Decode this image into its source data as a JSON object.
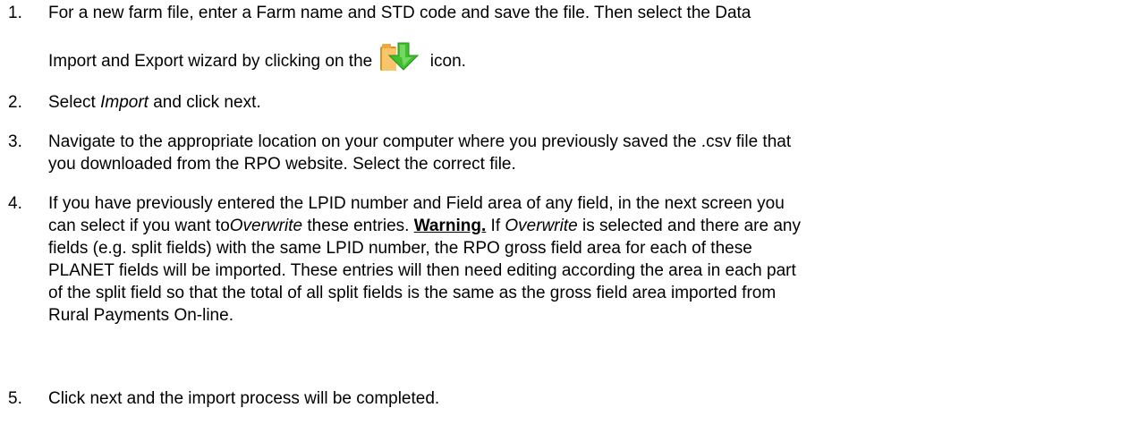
{
  "steps": [
    {
      "num": "1.",
      "line1": "For a new farm file, enter a Farm name and STD code and save the file. Then select the Data",
      "line2_before": "Import and Export wizard by clicking on the",
      "line2_after": "icon.",
      "icon": "folder-import-icon"
    },
    {
      "num": "2.",
      "before": "Select ",
      "em": "Import",
      "after": " and click next."
    },
    {
      "num": "3.",
      "line1": "Navigate to the appropriate location on your computer where you previously saved the .csv file that",
      "line2": "you downloaded from the RPO website. Select the correct file."
    },
    {
      "num": "4.",
      "l1": "If you have previously entered the LPID number and Field area of any field, in the next screen you",
      "l2_a": "can select if you want to",
      "l2_em": "Overwrite",
      "l2_b": " these entries. ",
      "l2_warn": "Warning.",
      "l2_c": " If ",
      "l2_em2": "Overwrite",
      "l2_d": " is selected and there are any",
      "l3": "fields (e.g. split fields) with the same LPID number, the RPO gross field area for each of these",
      "l4": "PLANET fields will be imported. These entries will then need editing according the area in each part",
      "l5": "of the split field so that the total of all split fields is the same as the gross field area imported from",
      "l6": "Rural Payments On-line."
    },
    {
      "num": "5.",
      "text": "Click next and the import process will be completed."
    }
  ],
  "colors": {
    "folder": "#f0a63a",
    "folder_light": "#f8c56a",
    "arrow": "#3fbf2c",
    "arrow_light": "#8fe07a"
  }
}
